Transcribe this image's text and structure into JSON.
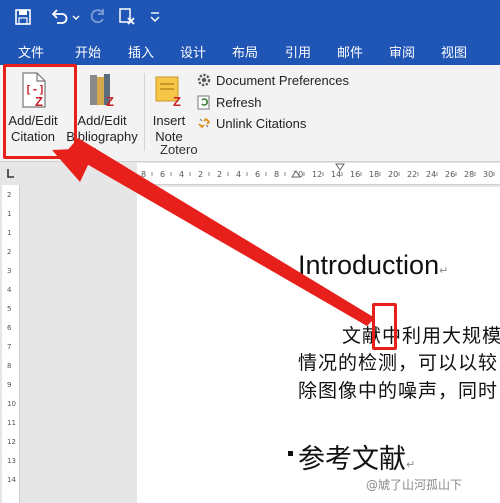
{
  "ribbon_tabs": [
    "文件",
    "开始",
    "插入",
    "设计",
    "布局",
    "引用",
    "邮件",
    "审阅",
    "视图"
  ],
  "zotero": {
    "add_edit_citation": [
      "Add/Edit",
      "Citation"
    ],
    "add_edit_bibliography": [
      "Add/Edit",
      "Bibliography"
    ],
    "insert_note": [
      "Insert",
      "Note"
    ],
    "document_preferences": "Document Preferences",
    "refresh": "Refresh",
    "unlink_citations": "Unlink Citations",
    "group_label": "Zotero"
  },
  "ruler": {
    "corner_icon": "tab-stop-icon",
    "h_ticks": [
      "8",
      "6",
      "4",
      "2",
      "2",
      "4",
      "6",
      "8",
      "10",
      "12",
      "14",
      "16",
      "18",
      "20",
      "22",
      "24",
      "26",
      "28",
      "30"
    ],
    "v_ticks": [
      "2",
      "1",
      "1",
      "2",
      "3",
      "4",
      "5",
      "6",
      "7",
      "8",
      "9",
      "10",
      "11",
      "12",
      "13",
      "14"
    ]
  },
  "document": {
    "heading": "Introduction",
    "lines": [
      "文献中利用大规模",
      "情况的检测，可以以较",
      "除图像中的噪声，同时"
    ],
    "subheading": "参考文献"
  },
  "watermark": "@虓了山河孤山下",
  "colors": {
    "title_bar": "#1f56b5",
    "ribbon": "#f3f3f3",
    "highlight": "#e8201c",
    "zotero_red": "#c8242b"
  }
}
